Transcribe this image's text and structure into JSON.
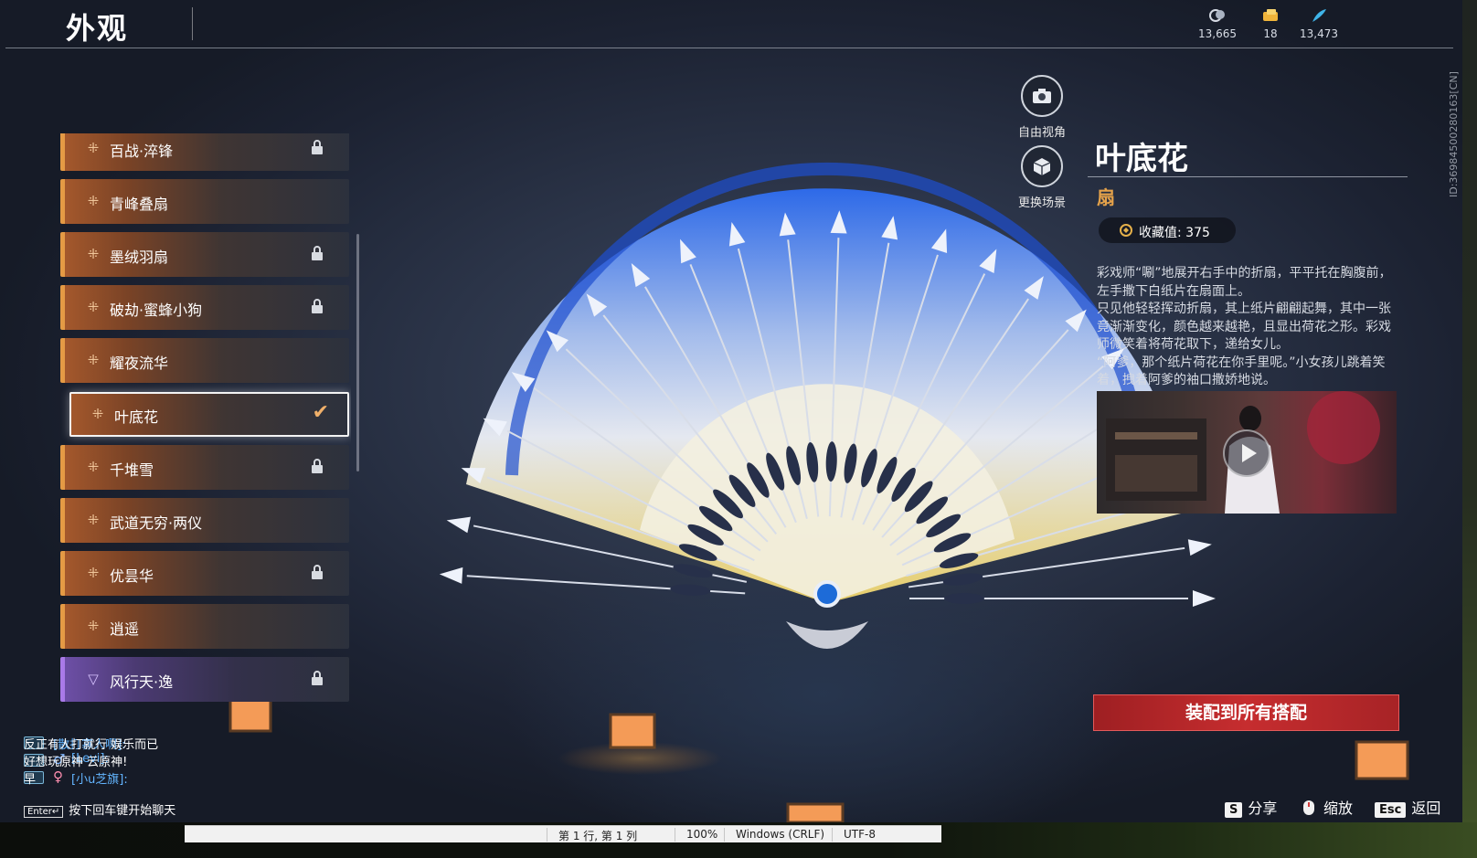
{
  "header": {
    "title": "外观",
    "currencies": [
      {
        "icon": "coin-stack-icon",
        "value": "13,665"
      },
      {
        "icon": "ticket-icon",
        "value": "18"
      },
      {
        "icon": "feather-icon",
        "value": "13,473"
      }
    ]
  },
  "skin_list": {
    "items": [
      {
        "label": "百战·淬锋",
        "rarity": "orange",
        "locked": true
      },
      {
        "label": "青峰叠扇",
        "rarity": "orange",
        "locked": false
      },
      {
        "label": "墨绒羽扇",
        "rarity": "orange",
        "locked": true
      },
      {
        "label": "破劫·蜜蜂小狗",
        "rarity": "orange",
        "locked": true
      },
      {
        "label": "耀夜流华",
        "rarity": "orange",
        "locked": false
      },
      {
        "label": "叶底花",
        "rarity": "orange",
        "locked": false,
        "selected": true
      },
      {
        "label": "千堆雪",
        "rarity": "orange",
        "locked": true
      },
      {
        "label": "武道无穷·两仪",
        "rarity": "orange",
        "locked": false
      },
      {
        "label": "优昙华",
        "rarity": "orange",
        "locked": true
      },
      {
        "label": "逍遥",
        "rarity": "orange",
        "locked": false
      },
      {
        "label": "风行天·逸",
        "rarity": "purple",
        "locked": true
      }
    ]
  },
  "view_buttons": {
    "free_view": "自由视角",
    "change_scene": "更换场景"
  },
  "detail": {
    "name": "叶底花",
    "type": "扇",
    "collection": "收藏值: 375",
    "description": [
      "彩戏师“唰”地展开右手中的折扇，平平托在胸腹前，左手撒下白纸片在扇面上。",
      "只见他轻轻挥动折扇，其上纸片翩翩起舞，其中一张竟渐渐变化，颜色越来越艳，且显出荷花之形。彩戏师微笑着将荷花取下，递给女儿。",
      "“阿爹，那个纸片荷花在你手里呢。”小女孩儿跳着笑着，拽着阿爹的袖口撒娇地说。"
    ],
    "equip_button": "装配到所有搭配",
    "side_id": "ID:3698450028016​3[CN]"
  },
  "hints": {
    "share_key": "S",
    "share": "分享",
    "zoom": "缩放",
    "back_key": "Esc",
    "back": "返回"
  },
  "chat": {
    "lines": [
      {
        "nick": "[散打寡人啊]:",
        "msg": "反正有人打就行 娱乐而已",
        "gender": ""
      },
      {
        "nick": "[Levi]:",
        "msg": "好想玩原神 云原神!",
        "gender": "♂"
      },
      {
        "nick": "[小u芝旗]:",
        "msg": "早",
        "gender": "♀"
      }
    ],
    "enter_key": "Enter↵",
    "hint": "按下回车键开始聊天"
  },
  "statusbar": {
    "position": "第 1 行, 第 1 列",
    "zoom": "100%",
    "line_ending": "Windows (CRLF)",
    "encoding": "UTF-8"
  },
  "colors": {
    "orange_rarity": "#e49a45",
    "purple_rarity": "#a97ae8",
    "equip_red": "#c62d2f",
    "type_gold": "#e5a24a",
    "chat_nick": "#63b5ff"
  }
}
